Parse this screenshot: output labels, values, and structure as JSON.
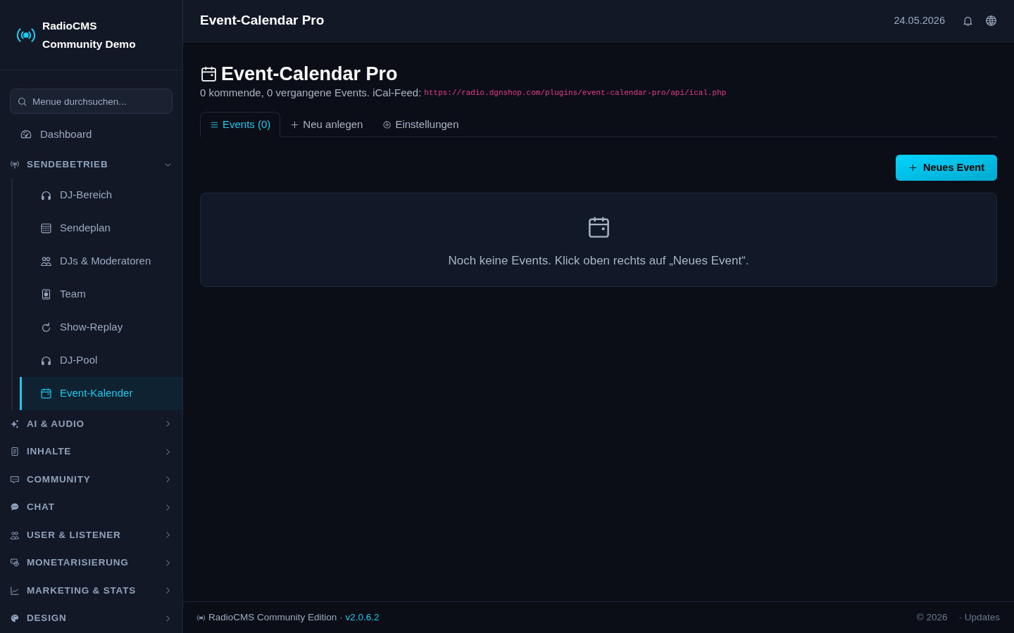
{
  "sidebar": {
    "brand": {
      "name": "RadioCMS",
      "tagline": "Community Demo"
    },
    "search": {
      "placeholder": "Menue durchsuchen..."
    },
    "nav": [
      {
        "kind": "link",
        "label": "Dashboard",
        "selected": false
      },
      {
        "kind": "group",
        "label": "SENDEBETRIEB",
        "expanded": true,
        "children": [
          {
            "label": "DJ-Bereich",
            "selected": false
          },
          {
            "label": "Sendeplan",
            "selected": false
          },
          {
            "label": "DJs & Moderatoren",
            "selected": false
          },
          {
            "label": "Team",
            "selected": false
          },
          {
            "label": "Show-Replay",
            "selected": false
          },
          {
            "label": "DJ-Pool",
            "selected": false
          },
          {
            "label": "Event-Kalender",
            "selected": true
          }
        ]
      },
      {
        "kind": "group",
        "label": "AI & AUDIO",
        "expanded": false
      },
      {
        "kind": "group",
        "label": "INHALTE",
        "expanded": false
      },
      {
        "kind": "group",
        "label": "COMMUNITY",
        "expanded": false
      },
      {
        "kind": "group",
        "label": "CHAT",
        "expanded": false
      },
      {
        "kind": "group",
        "label": "USER & LISTENER",
        "expanded": false
      },
      {
        "kind": "group",
        "label": "MONETARISIERUNG",
        "expanded": false
      },
      {
        "kind": "group",
        "label": "MARKETING & STATS",
        "expanded": false
      },
      {
        "kind": "group",
        "label": "DESIGN",
        "expanded": false
      }
    ]
  },
  "header": {
    "title": "Event-Calendar Pro",
    "date": "24.05.2026"
  },
  "page": {
    "title": "Event-Calendar Pro",
    "subtitle": "0 kommende, 0 vergangene Events. iCal-Feed:",
    "ical_url": "https://radio.dgnshop.com/plugins/event-calendar-pro/api/ical.php",
    "tabs": [
      {
        "label": "Events (0)",
        "selected": true
      },
      {
        "label": "Neu anlegen",
        "selected": false
      },
      {
        "label": "Einstellungen",
        "selected": false
      }
    ],
    "new_button": "Neues Event",
    "empty_message": "Noch keine Events. Klick oben rechts auf „Neues Event“."
  },
  "footer": {
    "edition": "RadioCMS Community Edition ·",
    "version": "v2.0.6.2",
    "copyright": "© 2026",
    "updates": "· Updates"
  }
}
